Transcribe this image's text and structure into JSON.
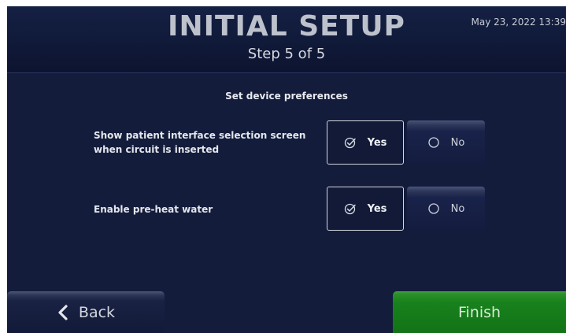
{
  "header": {
    "title": "INITIAL SETUP",
    "subtitle": "Step 5 of 5",
    "datetime": "May 23, 2022 13:39"
  },
  "main": {
    "section_title": "Set device preferences",
    "preferences": [
      {
        "label": "Show patient interface selection screen when circuit is inserted",
        "yes_label": "Yes",
        "no_label": "No",
        "selected": "Yes"
      },
      {
        "label": "Enable pre-heat water",
        "yes_label": "Yes",
        "no_label": "No",
        "selected": "Yes"
      }
    ]
  },
  "footer": {
    "back_label": "Back",
    "finish_label": "Finish"
  },
  "icons": {
    "selected": "check-circle-icon",
    "unselected": "radio-empty-icon",
    "back": "chevron-left-icon"
  },
  "colors": {
    "background": "#131c3b",
    "finish_green": "#18811c",
    "text": "#e4e7ed"
  }
}
